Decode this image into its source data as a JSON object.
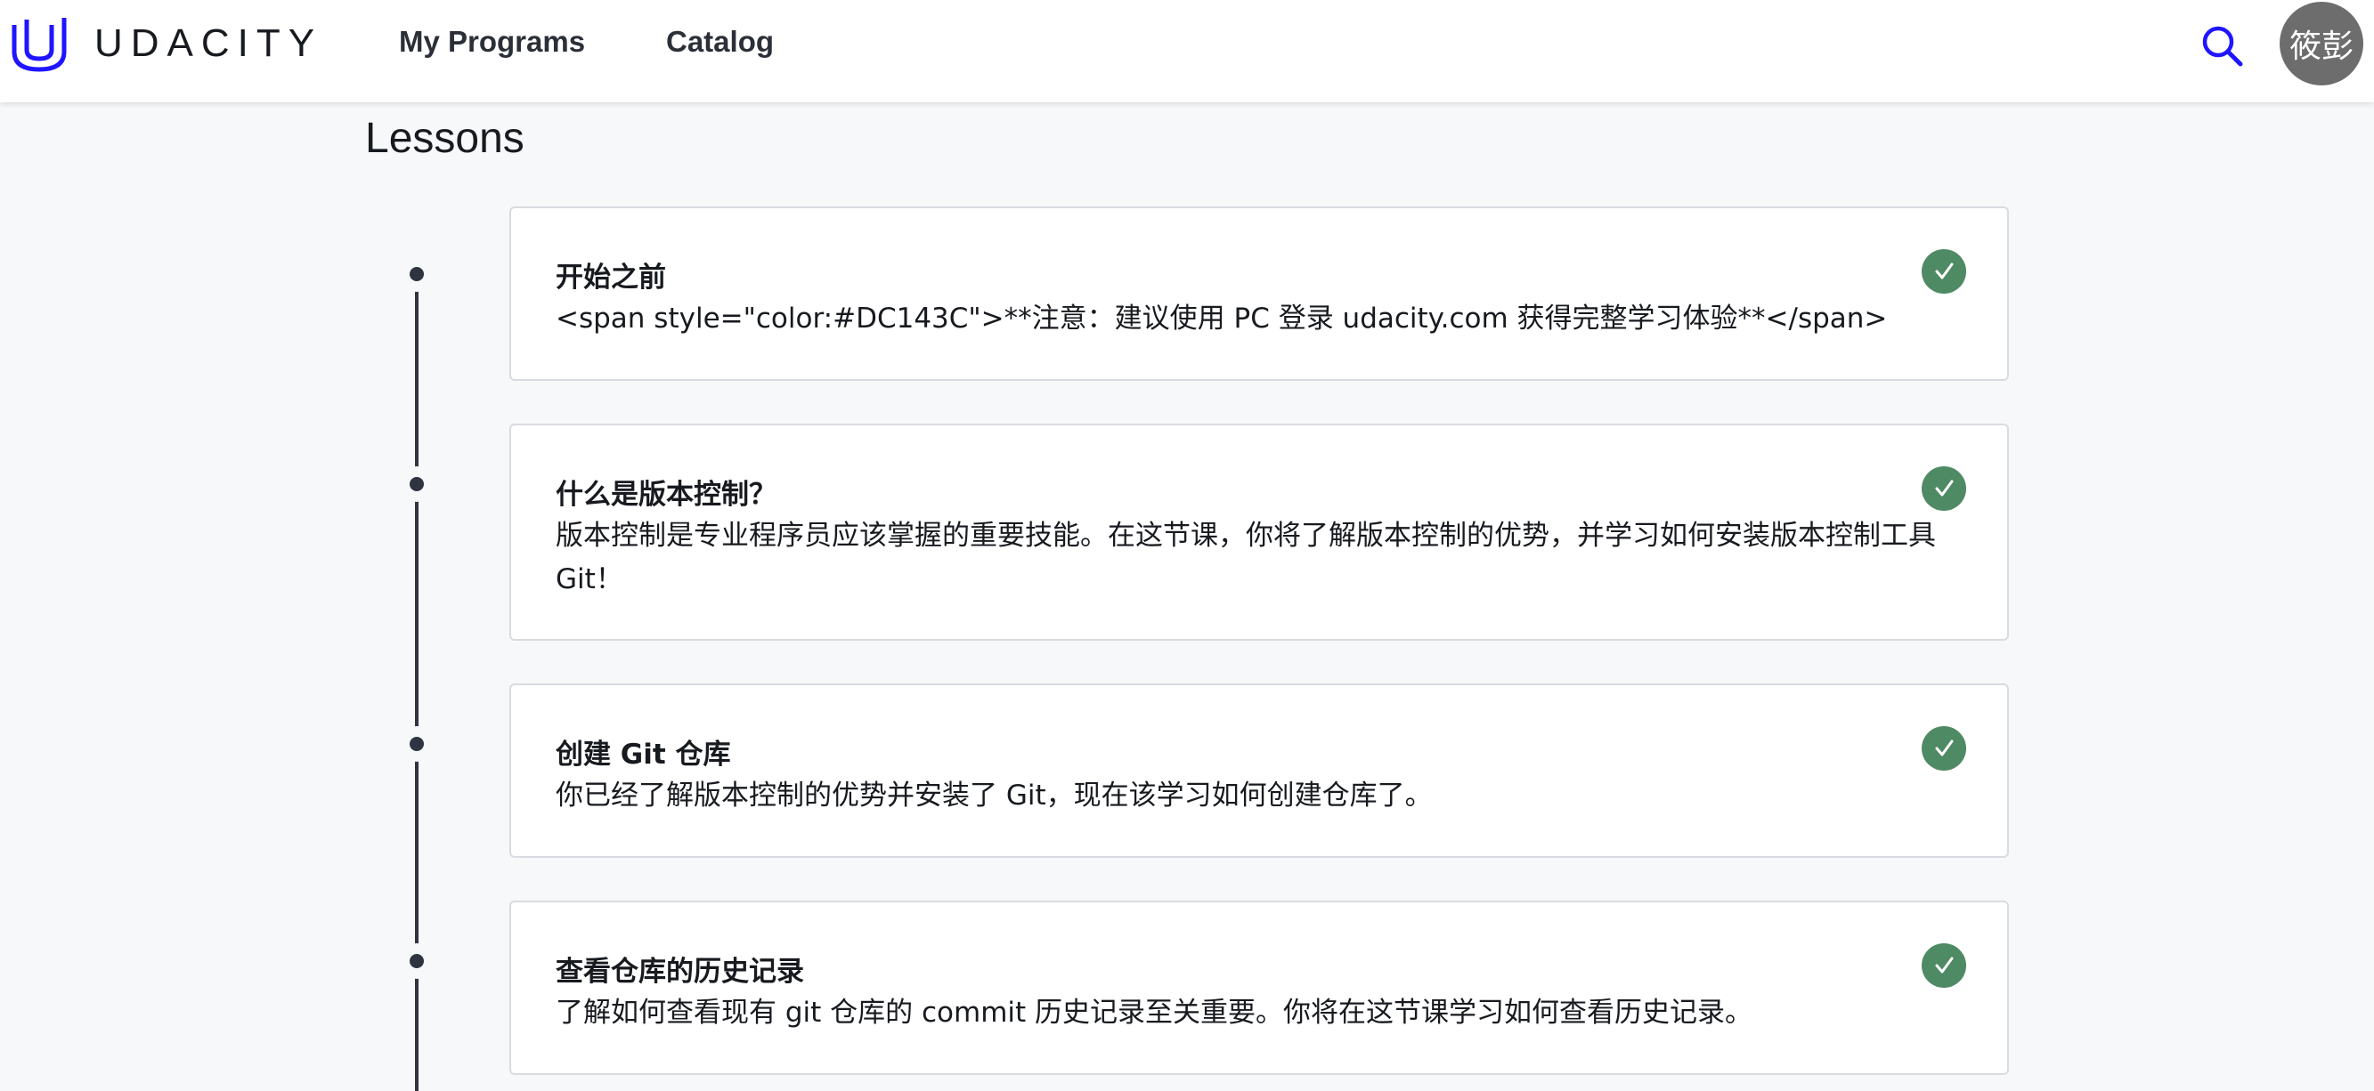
{
  "header": {
    "logo_text": "UDACITY",
    "nav": [
      "My Programs",
      "Catalog"
    ],
    "avatar_text": "筱彭",
    "brand_color": "#2015ff",
    "icons": [
      "udacity-logo",
      "search-icon"
    ]
  },
  "main": {
    "title": "Lessons",
    "completed_color": "#4e8a63",
    "lessons": [
      {
        "title": "开始之前",
        "description": "<span style=\"color:#DC143C\">**注意：建议使用 PC 登录 udacity.com 获得完整学习体验**</span>",
        "completed": true
      },
      {
        "title": "什么是版本控制？",
        "description": "版本控制是专业程序员应该掌握的重要技能。在这节课，你将了解版本控制的优势，并学习如何安装版本控制工具 Git！",
        "completed": true
      },
      {
        "title": "创建 Git 仓库",
        "description": "你已经了解版本控制的优势并安装了 Git，现在该学习如何创建仓库了。",
        "completed": true
      },
      {
        "title": "查看仓库的历史记录",
        "description": "了解如何查看现有 git 仓库的 commit 历史记录至关重要。你将在这节课学习如何查看历史记录。",
        "completed": true
      }
    ]
  }
}
